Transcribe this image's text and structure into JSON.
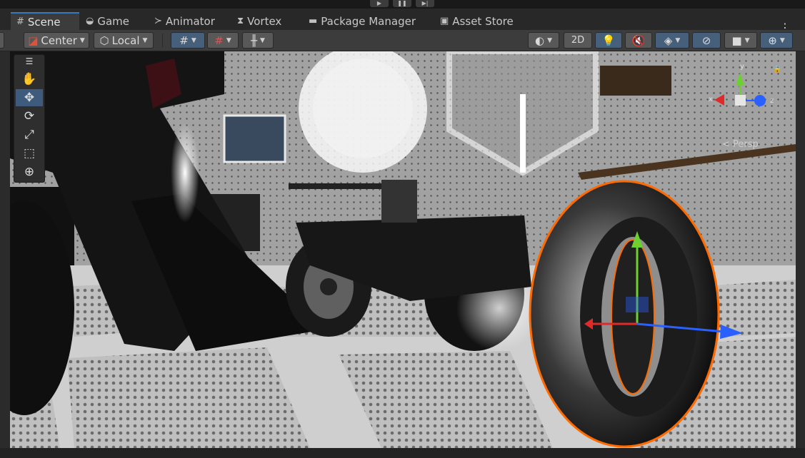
{
  "tabs": [
    {
      "label": "Scene",
      "icon": "grid-icon",
      "active": true
    },
    {
      "label": "Game",
      "icon": "gamepad-icon"
    },
    {
      "label": "Animator",
      "icon": "animator-icon"
    },
    {
      "label": "Vortex",
      "icon": "vortex-icon"
    },
    {
      "label": "Package Manager",
      "icon": "package-icon"
    },
    {
      "label": "Asset Store",
      "icon": "store-icon"
    }
  ],
  "toolbar": {
    "pivot_mode": "Center",
    "pivot_rotation": "Local",
    "twod_label": "2D"
  },
  "tools": [
    "hand-tool",
    "move-tool",
    "rotate-tool",
    "scale-tool",
    "rect-tool",
    "transform-tool"
  ],
  "gizmo": {
    "x_label": "x",
    "y_label": "y",
    "z_label": "z",
    "persp_label": "< Persp"
  },
  "colors": {
    "selection_outline": "#ff6a00",
    "axis_x": "#e02a2a",
    "axis_y": "#6ed030",
    "axis_z": "#2a60ff"
  }
}
